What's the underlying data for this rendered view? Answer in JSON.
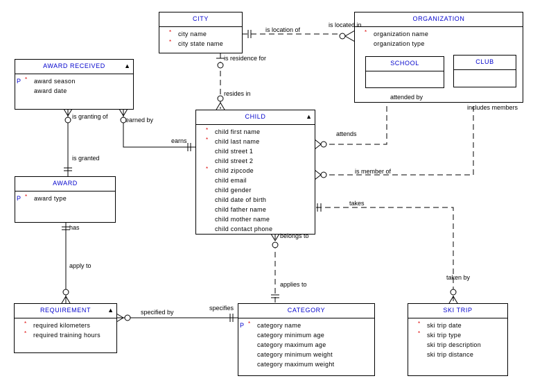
{
  "diagram": {
    "entities": {
      "city": {
        "name": "CITY",
        "has_toggle": false,
        "attributes": [
          {
            "label": "city name",
            "pk": false,
            "required": true
          },
          {
            "label": "city state name",
            "pk": false,
            "required": true
          }
        ]
      },
      "organization": {
        "name": "ORGANIZATION",
        "has_toggle": false,
        "attributes": [
          {
            "label": "organization name",
            "pk": false,
            "required": true
          },
          {
            "label": "organization type",
            "pk": false,
            "required": false
          }
        ]
      },
      "school": {
        "name": "SCHOOL",
        "attributes": []
      },
      "club": {
        "name": "CLUB",
        "attributes": []
      },
      "award_received": {
        "name": "AWARD RECEIVED",
        "has_toggle": true,
        "attributes": [
          {
            "label": "award season",
            "pk": true,
            "required": true
          },
          {
            "label": "award date",
            "pk": false,
            "required": false
          }
        ]
      },
      "child": {
        "name": "CHILD",
        "has_toggle": true,
        "attributes": [
          {
            "label": "child first name",
            "pk": false,
            "required": true
          },
          {
            "label": "child last name",
            "pk": false,
            "required": true
          },
          {
            "label": "child street 1",
            "pk": false,
            "required": false
          },
          {
            "label": "child street 2",
            "pk": false,
            "required": false
          },
          {
            "label": "child zipcode",
            "pk": false,
            "required": true
          },
          {
            "label": "child email",
            "pk": false,
            "required": false
          },
          {
            "label": "child gender",
            "pk": false,
            "required": false
          },
          {
            "label": "child date of birth",
            "pk": false,
            "required": false
          },
          {
            "label": "child father name",
            "pk": false,
            "required": false
          },
          {
            "label": "child mother name",
            "pk": false,
            "required": false
          },
          {
            "label": "child contact phone",
            "pk": false,
            "required": false
          }
        ]
      },
      "award": {
        "name": "AWARD",
        "has_toggle": false,
        "attributes": [
          {
            "label": "award type",
            "pk": true,
            "required": true
          }
        ]
      },
      "requirement": {
        "name": "REQUIREMENT",
        "has_toggle": true,
        "attributes": [
          {
            "label": "required kilometers",
            "pk": false,
            "required": true
          },
          {
            "label": "required training hours",
            "pk": false,
            "required": true
          }
        ]
      },
      "category": {
        "name": "CATEGORY",
        "has_toggle": false,
        "attributes": [
          {
            "label": "category name",
            "pk": true,
            "required": true
          },
          {
            "label": "category minimum age",
            "pk": false,
            "required": false
          },
          {
            "label": "category maximum age",
            "pk": false,
            "required": false
          },
          {
            "label": "category minimum weight",
            "pk": false,
            "required": false
          },
          {
            "label": "category maximum weight",
            "pk": false,
            "required": false
          }
        ]
      },
      "ski_trip": {
        "name": "SKI TRIP",
        "has_toggle": false,
        "attributes": [
          {
            "label": "ski trip date",
            "pk": false,
            "required": true
          },
          {
            "label": "ski trip type",
            "pk": false,
            "required": true
          },
          {
            "label": "ski trip description",
            "pk": false,
            "required": false
          },
          {
            "label": "ski trip distance",
            "pk": false,
            "required": false
          }
        ]
      }
    },
    "markers": {
      "pk": "P",
      "required": "*",
      "toggle": "▲"
    },
    "relationship_labels": {
      "is_location_of": "is location of",
      "is_located_in": "is located in",
      "is_residence_for": "is residence for",
      "resides_in": "resides in",
      "is_granting_of": "is granting of",
      "earned_by": "earned by",
      "earns": "earns",
      "is_granted": "is granted",
      "has": "has",
      "apply_to": "apply to",
      "attended_by": "attended by",
      "includes_members": "includes members",
      "attends": "attends",
      "is_member_of": "is member of",
      "takes": "takes",
      "taken_by": "taken by",
      "belongs_to": "belongs to",
      "applies_to": "applies to",
      "specified_by": "specified by",
      "specifies": "specifies"
    },
    "colors": {
      "entity_title": "#0000cc",
      "pk_marker": "#0000cc",
      "required_marker": "#dd0000",
      "line": "#000000"
    }
  }
}
